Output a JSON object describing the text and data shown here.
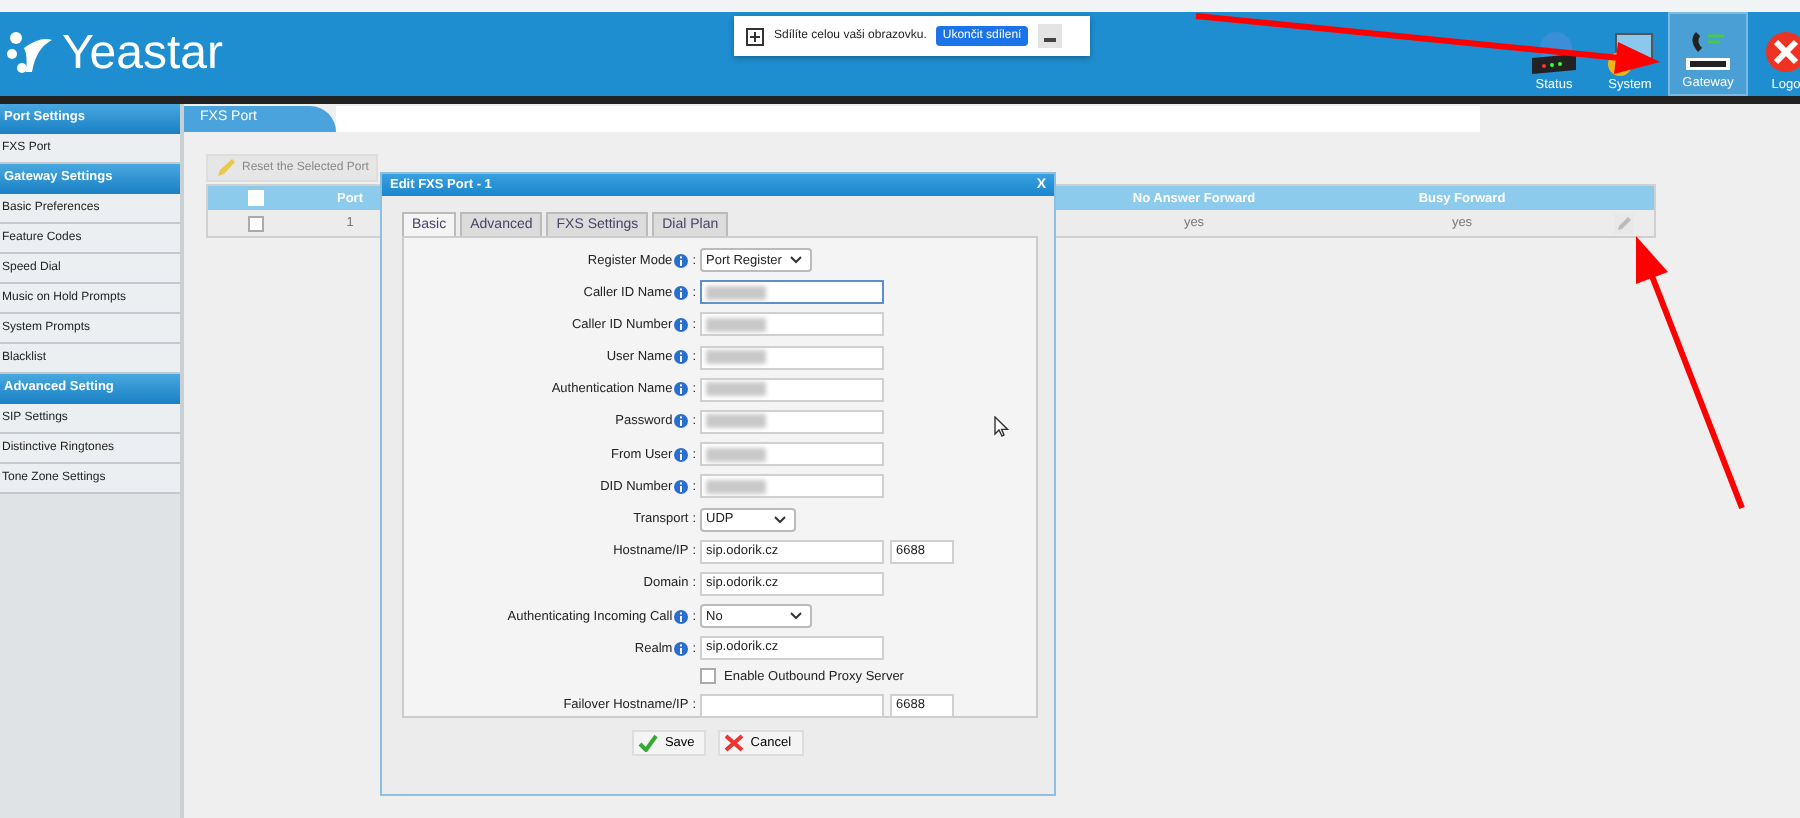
{
  "header": {
    "logo": "Yeastar",
    "nav": [
      {
        "label": "Status",
        "kind": "status",
        "selected": false
      },
      {
        "label": "System",
        "kind": "system",
        "selected": false
      },
      {
        "label": "Gateway",
        "kind": "gateway",
        "selected": true
      },
      {
        "label": "Logo",
        "kind": "logout",
        "selected": false
      }
    ]
  },
  "share_bar": {
    "text": "Sdílíte celou vaši obrazovku.",
    "button": "Ukončit sdílení"
  },
  "sidebar": {
    "sections": [
      {
        "title": "Port Settings",
        "items": [
          "FXS Port"
        ]
      },
      {
        "title": "Gateway Settings",
        "items": [
          "Basic Preferences",
          "Feature Codes",
          "Speed Dial",
          "Music on Hold Prompts",
          "System Prompts",
          "Blacklist"
        ]
      },
      {
        "title": "Advanced Setting",
        "items": [
          "SIP Settings",
          "Distinctive Ringtones",
          "Tone Zone Settings"
        ]
      }
    ]
  },
  "page": {
    "title": "FXS Port",
    "reset_button": "Reset the Selected Port",
    "table": {
      "all_checked": false,
      "columns": [
        "Port",
        "No Answer Forward",
        "Busy Forward"
      ],
      "rows": [
        {
          "checked": false,
          "port": "1",
          "no_answer_forward": "yes",
          "busy_forward": "yes"
        }
      ]
    }
  },
  "dialog": {
    "title": "Edit FXS Port - 1",
    "close": "X",
    "tabs": [
      {
        "label": "Basic",
        "selected": true
      },
      {
        "label": "Advanced",
        "selected": false
      },
      {
        "label": "FXS Settings",
        "selected": false
      },
      {
        "label": "Dial Plan",
        "selected": false
      }
    ],
    "fields": [
      {
        "kind": "select",
        "label": "Register Mode",
        "info": true,
        "colon": ":",
        "value": "Port Register",
        "wide": true
      },
      {
        "kind": "text",
        "label": "Caller ID Name",
        "info": true,
        "colon": ":",
        "redacted": true,
        "focused": true
      },
      {
        "kind": "text",
        "label": "Caller ID Number",
        "info": true,
        "colon": ":",
        "redacted": true
      },
      {
        "kind": "text",
        "label": "User Name",
        "info": true,
        "colon": ":",
        "redacted": true
      },
      {
        "kind": "text",
        "label": "Authentication Name",
        "info": true,
        "colon": ":",
        "redacted": true
      },
      {
        "kind": "text",
        "label": "Password",
        "info": true,
        "colon": ":",
        "redacted": true
      },
      {
        "kind": "text",
        "label": "From User",
        "info": true,
        "colon": ":",
        "redacted": true
      },
      {
        "kind": "text",
        "label": "DID Number",
        "info": true,
        "colon": ":",
        "redacted": true
      },
      {
        "kind": "select",
        "label": "Transport",
        "info": false,
        "colon": ":",
        "value": "UDP",
        "wide": false
      },
      {
        "kind": "host",
        "label": "Hostname/IP",
        "info": false,
        "colon": ":",
        "value": "sip.odorik.cz",
        "port": "6688"
      },
      {
        "kind": "text",
        "label": "Domain",
        "info": false,
        "colon": ":",
        "value": "sip.odorik.cz"
      },
      {
        "kind": "select",
        "label": "Authenticating Incoming Call",
        "info": true,
        "colon": ":",
        "value": "No",
        "wide": true
      },
      {
        "kind": "text",
        "label": "Realm",
        "info": true,
        "colon": ":",
        "value": "sip.odorik.cz"
      },
      {
        "kind": "checkbox",
        "label": "Enable Outbound Proxy Server",
        "checked": false
      },
      {
        "kind": "host",
        "label": "Failover Hostname/IP",
        "info": false,
        "colon": ":",
        "port": "6688"
      }
    ],
    "save": "Save",
    "cancel": "Cancel"
  }
}
